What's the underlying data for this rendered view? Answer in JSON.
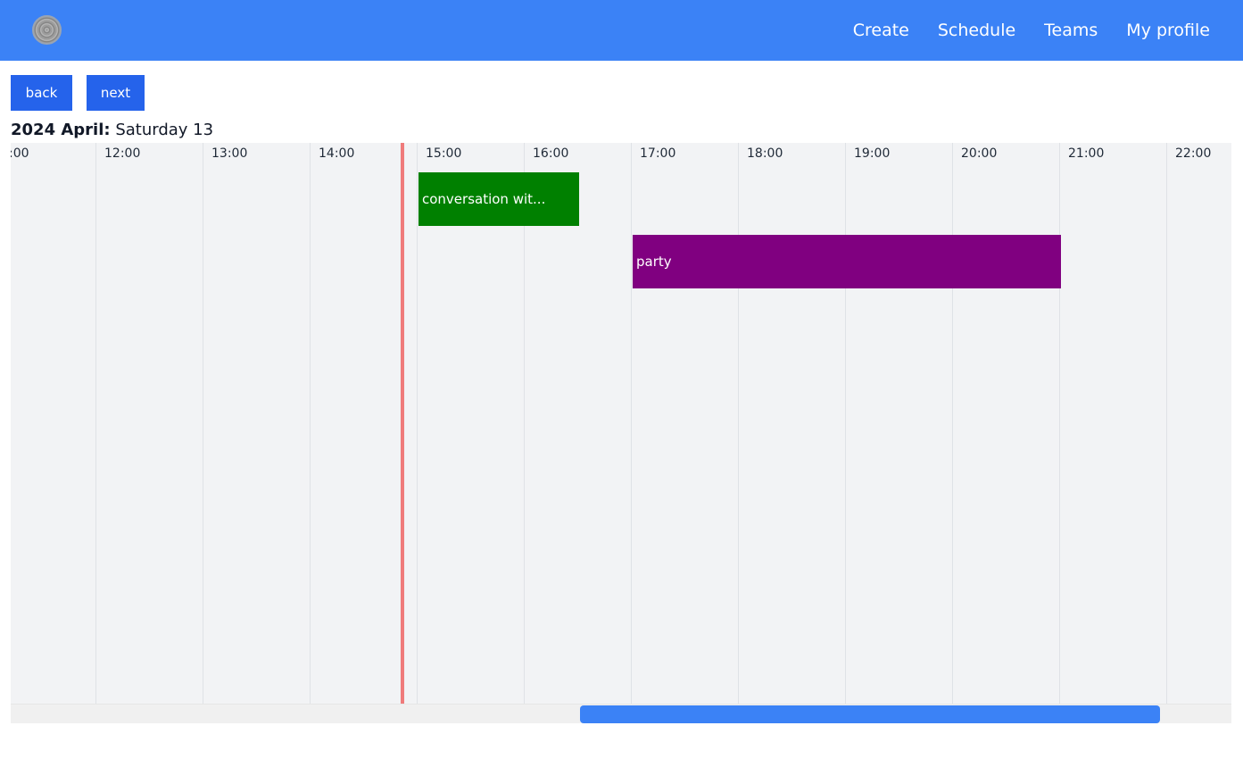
{
  "nav": {
    "links": [
      "Create",
      "Schedule",
      "Teams",
      "My profile"
    ]
  },
  "controls": {
    "back_label": "back",
    "next_label": "next"
  },
  "date": {
    "strong": "2024 April:",
    "rest": " Saturday 13"
  },
  "timeline": {
    "hour_labels": [
      ":00",
      "12:00",
      "13:00",
      "14:00",
      "15:00",
      "16:00",
      "17:00",
      "18:00",
      "19:00",
      "20:00",
      "21:00",
      "22:00"
    ],
    "events": [
      {
        "title": "conversation wit...",
        "color": "#008000",
        "start": "15:00",
        "end": "16:30"
      },
      {
        "title": "party",
        "color": "#800080",
        "start": "17:00",
        "end": "21:00"
      }
    ],
    "now_line_color": "#ef7b7b"
  },
  "colors": {
    "navbar": "#3b82f6",
    "button": "#2563eb",
    "scrollbar_thumb": "#3b82f6"
  }
}
